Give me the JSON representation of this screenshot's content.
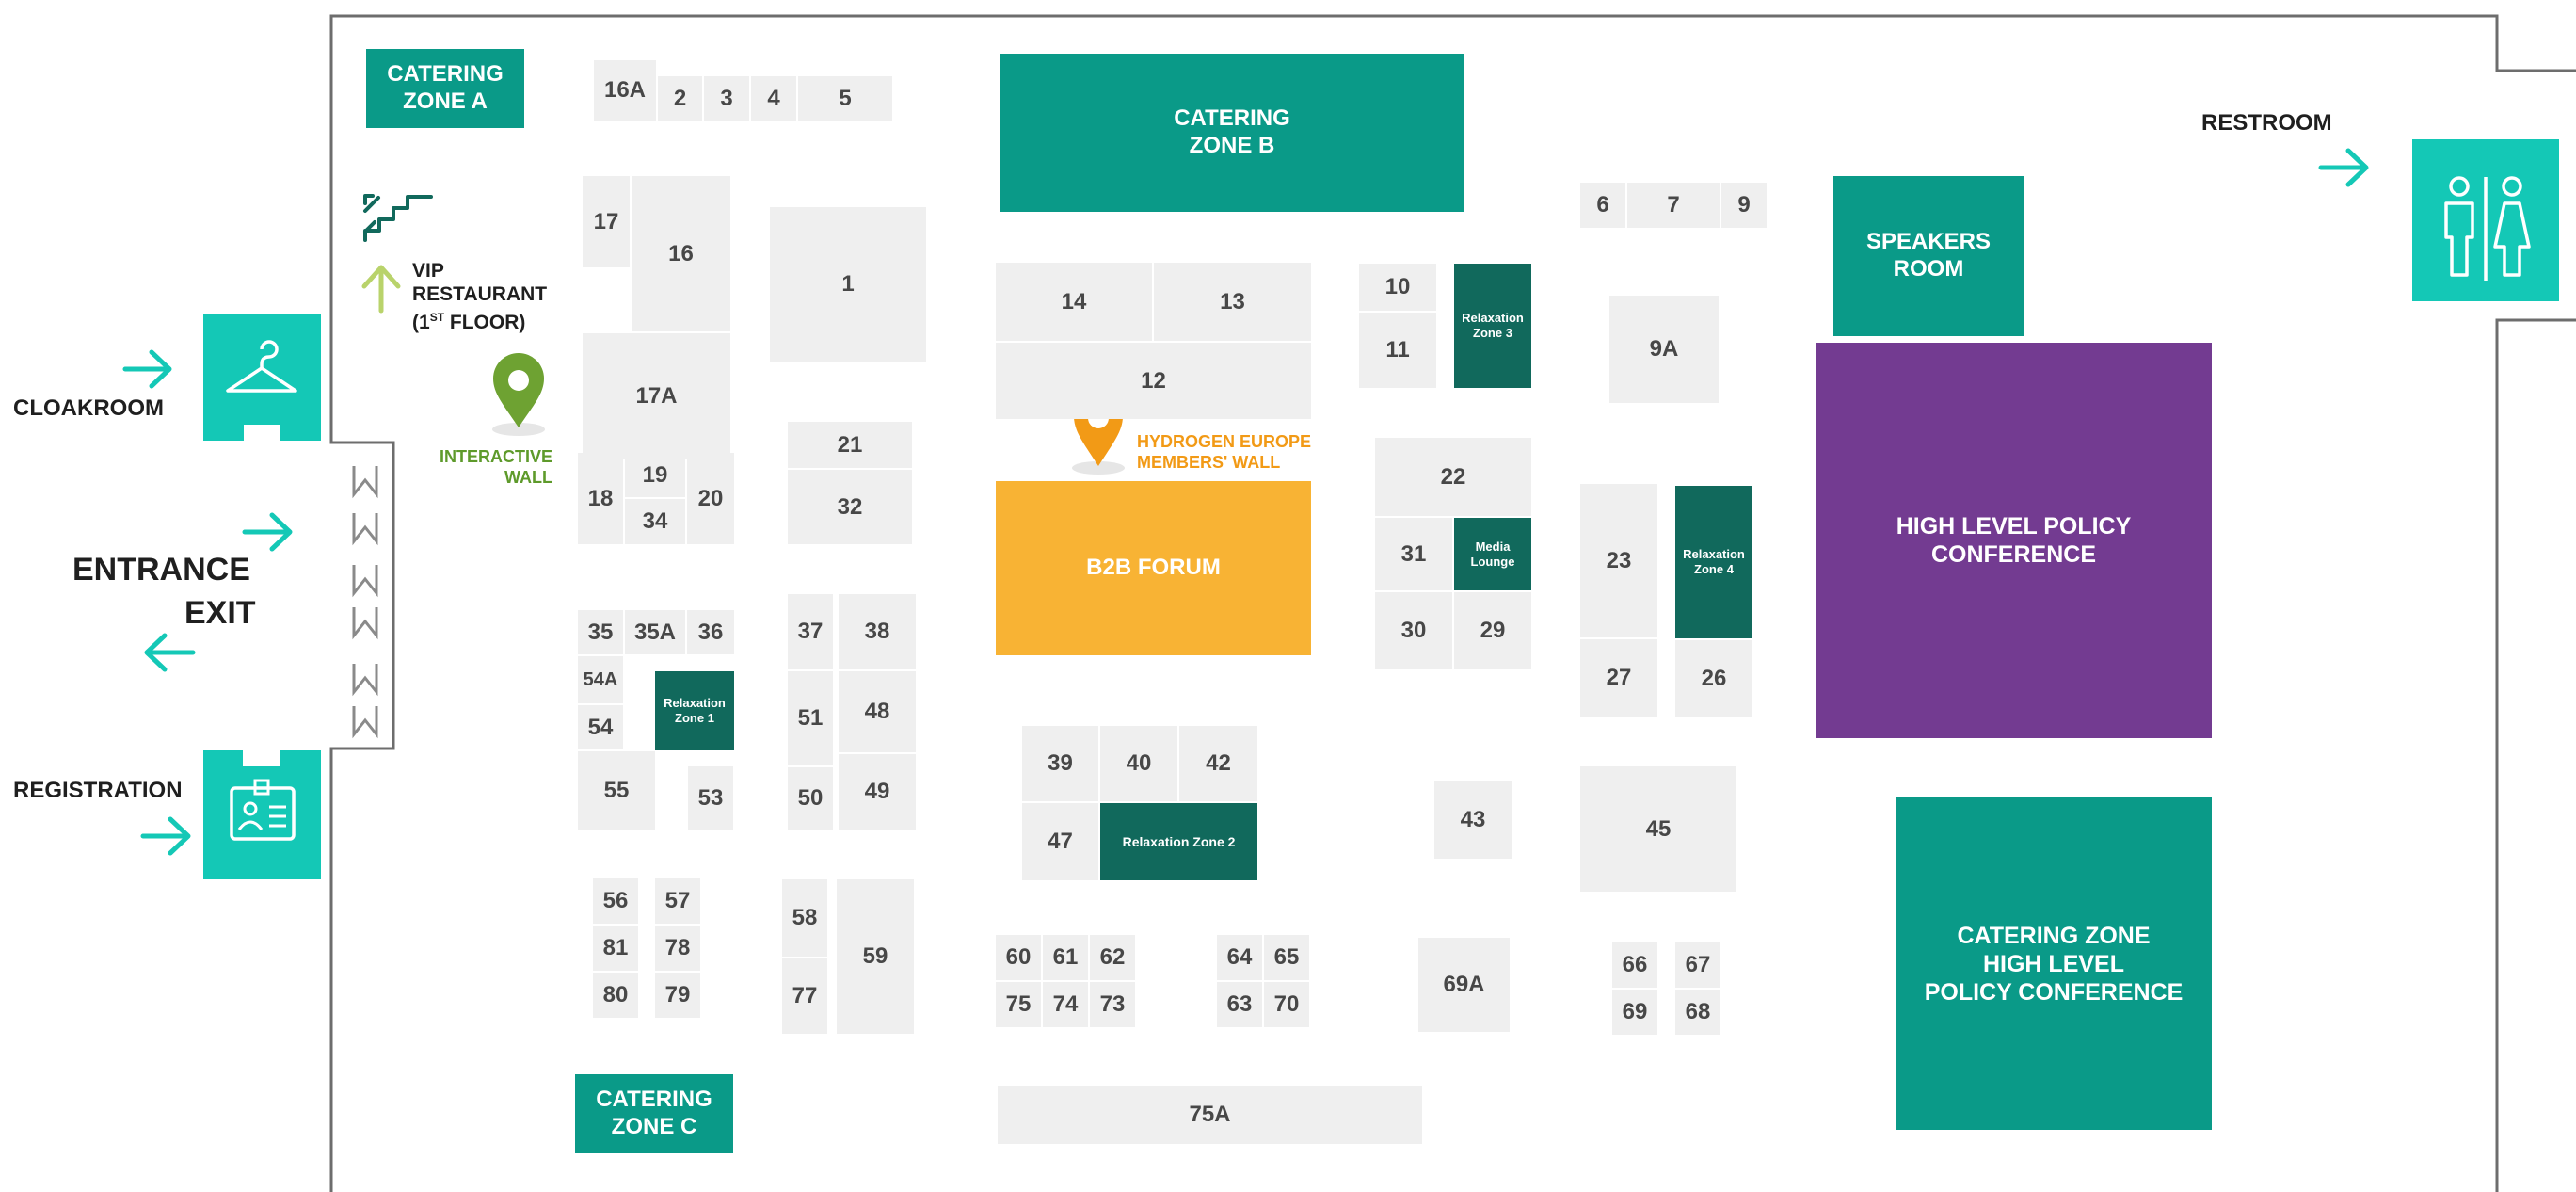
{
  "colors": {
    "booth": "#efefef",
    "booth_text": "#474747",
    "catering": "#0a9a88",
    "relaxation": "#11695c",
    "b2b": "#f8b334",
    "conference": "#733b91",
    "side_tile": "#14c8b6",
    "arrow": "#14c8b6",
    "interactive_pin": "#6ea232",
    "members_pin": "#f29a16"
  },
  "zones": {
    "catering_a": "CATERING\nZONE A",
    "catering_b": "CATERING\nZONE B",
    "catering_c": "CATERING\nZONE C",
    "catering_hl": "CATERING ZONE\nHIGH LEVEL\nPOLICY CONFERENCE",
    "speakers": "SPEAKERS\nROOM",
    "hlpc": "HIGH LEVEL POLICY\nCONFERENCE",
    "b2b": "B2B FORUM",
    "media": "Media\nLounge",
    "relax1": "Relaxation\nZone 1",
    "relax2": "Relaxation Zone 2",
    "relax3": "Relaxation\nZone 3",
    "relax4": "Relaxation\nZone 4"
  },
  "labels": {
    "cloakroom": "CLOAKROOM",
    "entrance": "ENTRANCE",
    "exit": "EXIT",
    "registration": "REGISTRATION",
    "restroom": "RESTROOM",
    "vip_line1": "VIP",
    "vip_line2": "RESTAURANT",
    "vip_line3_a": "(1",
    "vip_line3_sup": "ST",
    "vip_line3_b": " FLOOR)",
    "interactive_1": "INTERACTIVE",
    "interactive_2": "WALL",
    "members_1": "HYDROGEN EUROPE",
    "members_2": "MEMBERS' WALL"
  },
  "booths": {
    "b16A": "16A",
    "b2": "2",
    "b3": "3",
    "b4": "4",
    "b5": "5",
    "b17": "17",
    "b16": "16",
    "b17A": "17A",
    "b1": "1",
    "b14": "14",
    "b13": "13",
    "b12": "12",
    "b10": "10",
    "b11": "11",
    "b6": "6",
    "b7": "7",
    "b9": "9",
    "b9A": "9A",
    "b18": "18",
    "b19": "19",
    "b34": "34",
    "b20": "20",
    "b21": "21",
    "b32": "32",
    "b22": "22",
    "b31": "31",
    "b30": "30",
    "b29": "29",
    "b23": "23",
    "b27": "27",
    "b26": "26",
    "b35": "35",
    "b35A": "35A",
    "b36": "36",
    "b54A": "54A",
    "b54": "54",
    "b55": "55",
    "b53": "53",
    "b37": "37",
    "b38": "38",
    "b51": "51",
    "b48": "48",
    "b50": "50",
    "b49": "49",
    "b39": "39",
    "b40": "40",
    "b42": "42",
    "b47": "47",
    "b43": "43",
    "b45": "45",
    "b56": "56",
    "b57": "57",
    "b81": "81",
    "b78": "78",
    "b80": "80",
    "b79": "79",
    "b58": "58",
    "b77": "77",
    "b59": "59",
    "b60": "60",
    "b61": "61",
    "b62": "62",
    "b75": "75",
    "b74": "74",
    "b73": "73",
    "b64": "64",
    "b65": "65",
    "b63": "63",
    "b70": "70",
    "b69A": "69A",
    "b66": "66",
    "b67": "67",
    "b69": "69",
    "b68": "68",
    "b75A": "75A"
  }
}
